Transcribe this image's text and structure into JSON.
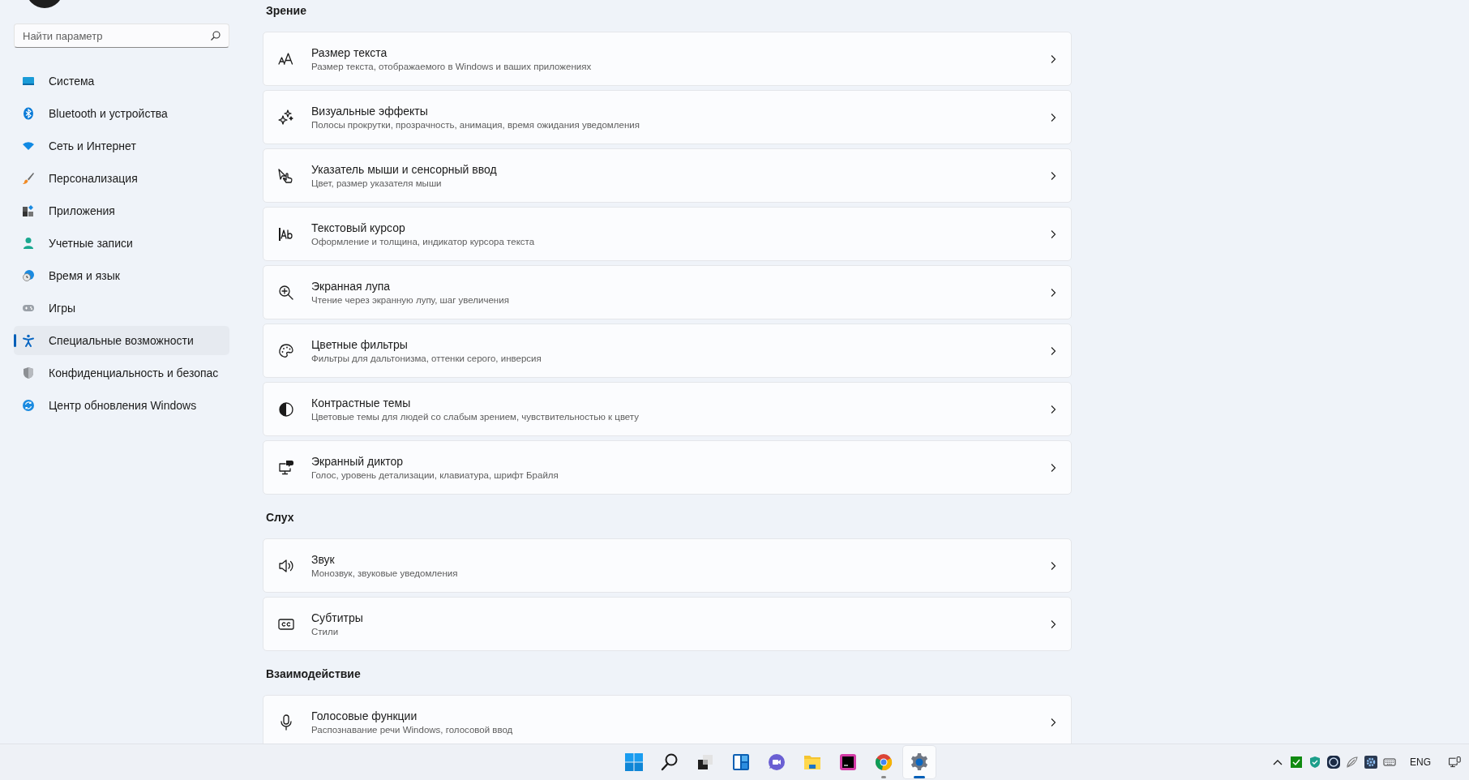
{
  "search": {
    "placeholder": "Найти параметр"
  },
  "nav": [
    {
      "kind": "system",
      "label": "Система",
      "selected": false
    },
    {
      "kind": "bluetooth",
      "label": "Bluetooth и устройства",
      "selected": false
    },
    {
      "kind": "network",
      "label": "Сеть и Интернет",
      "selected": false
    },
    {
      "kind": "brush",
      "label": "Персонализация",
      "selected": false
    },
    {
      "kind": "apps",
      "label": "Приложения",
      "selected": false
    },
    {
      "kind": "account",
      "label": "Учетные записи",
      "selected": false
    },
    {
      "kind": "time",
      "label": "Время и язык",
      "selected": false
    },
    {
      "kind": "games",
      "label": "Игры",
      "selected": false
    },
    {
      "kind": "accessibility",
      "label": "Специальные возможности",
      "selected": true
    },
    {
      "kind": "shield",
      "label": "Конфиденциальность и безопас",
      "selected": false
    },
    {
      "kind": "update",
      "label": "Центр обновления Windows",
      "selected": false
    }
  ],
  "sections": [
    {
      "heading": "Зрение",
      "items": [
        {
          "kind": "textsize",
          "title": "Размер текста",
          "subtitle": "Размер текста, отображаемого в Windows и ваших приложениях"
        },
        {
          "kind": "sparkle",
          "title": "Визуальные эффекты",
          "subtitle": "Полосы прокрутки, прозрачность, анимация, время ожидания уведомления"
        },
        {
          "kind": "pointer",
          "title": "Указатель мыши и сенсорный ввод",
          "subtitle": "Цвет, размер указателя мыши"
        },
        {
          "kind": "cursor",
          "title": "Текстовый курсор",
          "subtitle": "Оформление и толщина, индикатор курсора текста"
        },
        {
          "kind": "magnifier",
          "title": "Экранная лупа",
          "subtitle": "Чтение через экранную лупу, шаг увеличения"
        },
        {
          "kind": "palette",
          "title": "Цветные фильтры",
          "subtitle": "Фильтры для дальтонизма, оттенки серого, инверсия"
        },
        {
          "kind": "contrast",
          "title": "Контрастные темы",
          "subtitle": "Цветовые темы для людей со слабым зрением, чувствительностью к цвету"
        },
        {
          "kind": "narrator",
          "title": "Экранный диктор",
          "subtitle": "Голос, уровень детализации, клавиатура, шрифт Брайля"
        }
      ]
    },
    {
      "heading": "Слух",
      "items": [
        {
          "kind": "speaker",
          "title": "Звук",
          "subtitle": "Монозвук, звуковые уведомления"
        },
        {
          "kind": "captions",
          "title": "Субтитры",
          "subtitle": "Стили"
        }
      ]
    },
    {
      "heading": "Взаимодействие",
      "items": [
        {
          "kind": "mic",
          "title": "Голосовые функции",
          "subtitle": "Распознавание речи Windows, голосовой ввод"
        }
      ]
    }
  ],
  "taskbar": {
    "apps": [
      {
        "kind": "start",
        "selected": false,
        "running": false
      },
      {
        "kind": "search",
        "selected": false,
        "running": false
      },
      {
        "kind": "taskview",
        "selected": false,
        "running": false
      },
      {
        "kind": "widgets",
        "selected": false,
        "running": false
      },
      {
        "kind": "chat",
        "selected": false,
        "running": false
      },
      {
        "kind": "folder",
        "selected": false,
        "running": false
      },
      {
        "kind": "ide",
        "selected": false,
        "running": false
      },
      {
        "kind": "browser",
        "selected": false,
        "running": true
      },
      {
        "kind": "settings",
        "selected": true,
        "running": true
      }
    ],
    "tray": [
      {
        "kind": "chevron"
      },
      {
        "kind": "check"
      },
      {
        "kind": "shieldcheck"
      },
      {
        "kind": "ring"
      },
      {
        "kind": "feather"
      },
      {
        "kind": "gear"
      },
      {
        "kind": "keyboard"
      }
    ],
    "language": "ENG"
  }
}
